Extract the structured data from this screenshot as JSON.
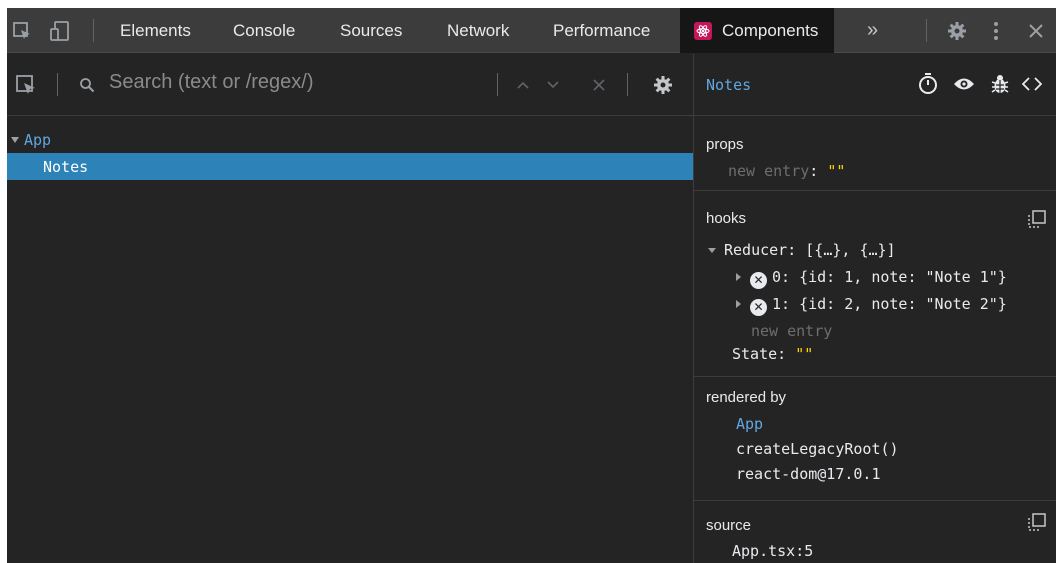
{
  "tabs": {
    "elements": "Elements",
    "console": "Console",
    "sources": "Sources",
    "network": "Network",
    "performance": "Performance",
    "components": "Components",
    "overflow": "»"
  },
  "search": {
    "placeholder": "Search (text or /regex/)"
  },
  "tree": {
    "root": "App",
    "selected": "Notes"
  },
  "inspector": {
    "title": "Notes",
    "props": {
      "heading": "props",
      "new_entry_key": "new entry",
      "new_entry_value": "\"\""
    },
    "hooks": {
      "heading": "hooks",
      "reducer_key": "Reducer:",
      "reducer_value": "[{…}, {…}]",
      "items": [
        {
          "index": "0:",
          "value": "{id: 1, note: \"Note 1\"}"
        },
        {
          "index": "1:",
          "value": "{id: 2, note: \"Note 2\"}"
        }
      ],
      "new_entry": "new entry",
      "state_key": "State:",
      "state_value": "\"\""
    },
    "rendered_by": {
      "heading": "rendered by",
      "entries": [
        "App",
        "createLegacyRoot()",
        "react-dom@17.0.1"
      ]
    },
    "source": {
      "heading": "source",
      "location": "App.tsx:5"
    }
  },
  "icons": {
    "toolbar": [
      "inspect-element-icon",
      "device-toolbar-icon",
      "settings-gear-icon",
      "more-vertical-icon",
      "close-icon"
    ],
    "search": [
      "select-component-icon",
      "search-icon",
      "previous-result-icon",
      "next-result-icon",
      "clear-search-icon",
      "settings-gear-icon"
    ],
    "inspector": [
      "stopwatch-icon",
      "eye-icon",
      "bug-icon",
      "view-source-icon",
      "copy-icon"
    ]
  },
  "colors": {
    "accent_blue": "#61a6e0",
    "selection_bg": "#2d82b7",
    "string_yellow": "#ffd400",
    "panel_bg": "#242424",
    "tabbar_bg": "#3c3c3c"
  }
}
